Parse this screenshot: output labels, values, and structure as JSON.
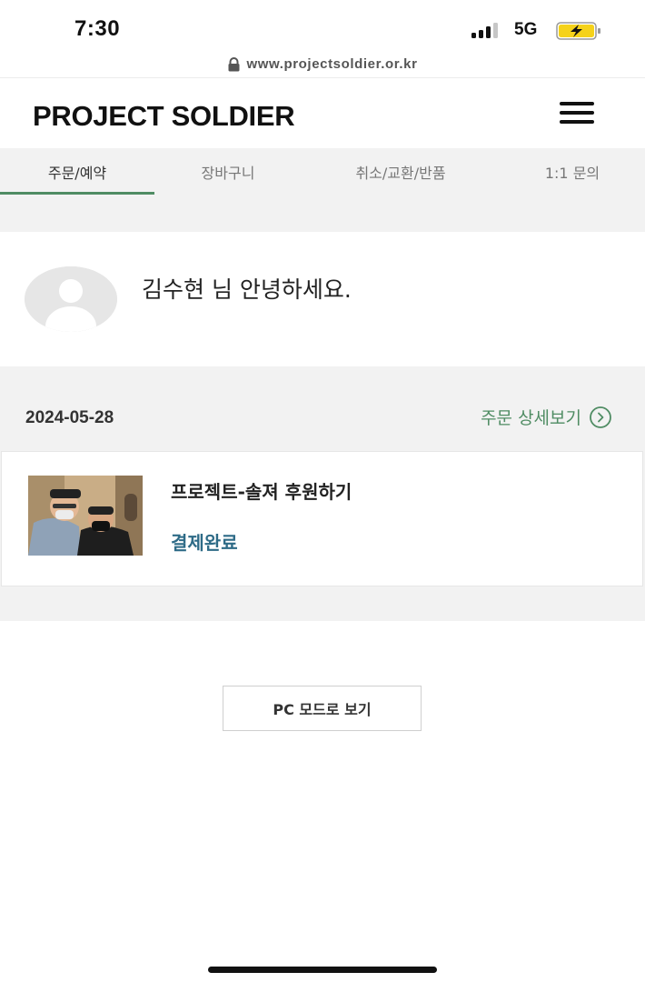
{
  "status_bar": {
    "time": "7:30",
    "network": "5G",
    "signal_icon": "cellular-signal-icon",
    "battery_icon": "battery-charging-icon",
    "battery_color": "#f5d21a"
  },
  "url_bar": {
    "lock_icon": "lock-icon",
    "url": "www.projectsoldier.or.kr"
  },
  "header": {
    "brand": "PROJECT SOLDIER",
    "menu_icon": "hamburger-menu-icon"
  },
  "tabs": [
    {
      "label": "주문/예약",
      "active": true
    },
    {
      "label": "장바구니",
      "active": false
    },
    {
      "label": "취소/교환/반품",
      "active": false
    },
    {
      "label": "1:1 문의",
      "active": false
    }
  ],
  "profile": {
    "avatar_icon": "user-avatar-icon",
    "greeting": "김수현 님 안녕하세요."
  },
  "order": {
    "date": "2024-05-28",
    "detail_link": "주문 상세보기",
    "detail_icon": "chevron-right-circle-icon",
    "item": {
      "thumbnail_icon": "product-photo",
      "name": "프로젝트-솔져 후원하기",
      "status": "결제완료"
    }
  },
  "footer": {
    "pc_mode_button": "PC 모드로 보기"
  },
  "colors": {
    "accent_green": "#4f8c63",
    "status_blue": "#2e6b87",
    "band_gray": "#f2f2f2"
  }
}
